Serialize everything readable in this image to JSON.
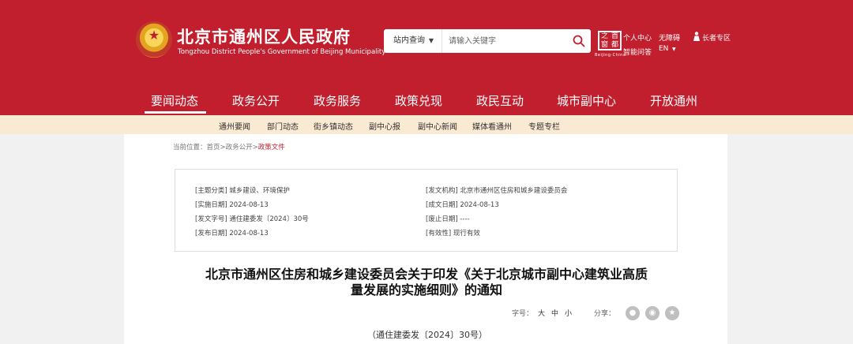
{
  "header": {
    "title": "北京市通州区人民政府",
    "subtitle": "Tongzhou District People's Government of Beijing Municipality",
    "search": {
      "scope": "站内查询",
      "placeholder": "请输入关键字"
    },
    "bj_logo": {
      "chars": [
        "之",
        "首",
        "窗",
        "都"
      ],
      "caption": "Beijing·China"
    },
    "links": {
      "personal_center": "个人中心",
      "accessibility": "无障碍",
      "smart_q": "智能问答",
      "lang": "EN",
      "elder": "长者专区"
    }
  },
  "nav": {
    "items": [
      "要闻动态",
      "政务公开",
      "政务服务",
      "政策兑现",
      "政民互动",
      "城市副中心",
      "开放通州"
    ],
    "active_index": 0
  },
  "subnav": {
    "items": [
      "通州要闻",
      "部门动态",
      "街乡镇动态",
      "副中心报",
      "副中心新闻",
      "媒体看通州",
      "专题专栏"
    ]
  },
  "breadcrumb": {
    "prefix": "当前位置：",
    "home": "首页",
    "sep1": ">",
    "level1": "政务公开",
    "sep2": ">",
    "current": "政策文件"
  },
  "meta": {
    "theme": "[主题分类] 城乡建设、环境保护",
    "impl_date": "[实施日期] 2024-08-13",
    "doc_no": "[发文字号] 通住建委发〔2024〕30号",
    "pub_date": "[发布日期] 2024-08-13",
    "issuer": "[发文机构] 北京市通州区住房和城乡建设委员会",
    "written_date": "[成文日期] 2024-08-13",
    "abolish_date": "[废止日期] ----",
    "validity": "[有效性] 现行有效"
  },
  "document": {
    "title_line1": "北京市通州区住房和城乡建设委员会关于印发《关于北京城市副中心建筑业高质",
    "title_line2": "量发展的实施细则》的通知",
    "font_label": "字号：",
    "font_sizes": [
      "大",
      "中",
      "小"
    ],
    "share_label": "分享：",
    "number": "（通住建委发〔2024〕30号）"
  },
  "colors": {
    "brand_red": "#c21f2e",
    "subnav_bg": "#fae9d3",
    "side_gray": "#f1f1f1",
    "share_gray": "#bfbfbf"
  },
  "icons": {
    "search": "search-icon",
    "emblem": "national-emblem-icon",
    "elder": "person-icon",
    "share": [
      "wechat-icon",
      "weibo-icon",
      "qzone-star-icon"
    ]
  }
}
